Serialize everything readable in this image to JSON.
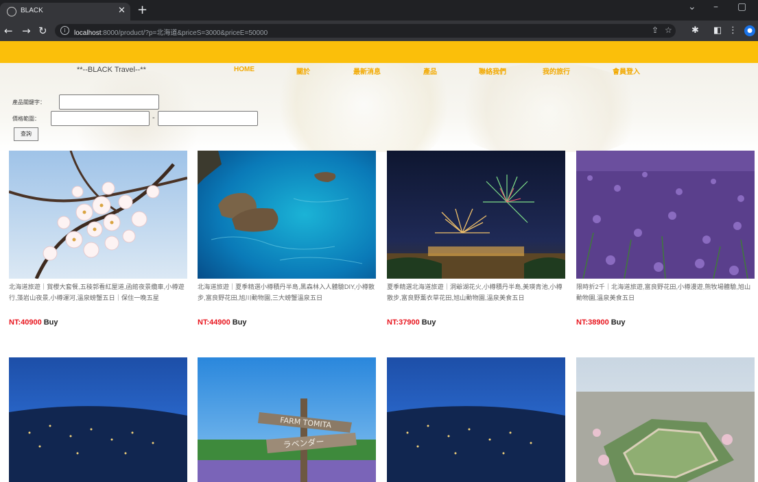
{
  "browser": {
    "tab_title": "BLACK",
    "url_host": "localhost",
    "url_rest": ":8000/product/?p=北海道&priceS=3000&priceE=50000"
  },
  "site": {
    "brand": "**--BLACK Travel--**",
    "nav": [
      "HOME",
      "關於",
      "最新消息",
      "產品",
      "聯絡我們",
      "我的旅行",
      "會員登入"
    ],
    "accent_color": "#fbbf0a",
    "nav_color": "#f2a900",
    "price_color": "#e8131c"
  },
  "search": {
    "keyword_label": "產品關鍵字：",
    "price_label": "價格範圍：",
    "price_separator": "-",
    "submit_label": "查詢"
  },
  "products": [
    {
      "desc": "北海道旅遊｜賞櫻大套餐,五稜郭看紅屋道,函館夜景纜車,小樽遊行,藻岩山夜景,小樽運河,溫泉螃蟹五日｜保住一晚五星",
      "price": "NT:40900",
      "buy": "Buy",
      "image": "cherry-blossom"
    },
    {
      "desc": "北海道旅遊｜夏季精選小樽積丹半島,黑森林入人體驗DIY,小樽散步,富良野花田,旭川動物園,三大螃蟹溫泉五日",
      "price": "NT:44900",
      "buy": "Buy",
      "image": "blue-sea-rocks"
    },
    {
      "desc": "夏季精選北海道旅遊｜洞爺湖花火,小樽積丹半島,美瑛青池,小樽散步,富良野薰衣草花田,旭山動物園,溫泉美食五日",
      "price": "NT:37900",
      "buy": "Buy",
      "image": "fireworks"
    },
    {
      "desc": "限時折2千｜北海道旅遊,富良野花田,小樽漫遊,熊牧場體驗,旭山動物園,溫泉美食五日",
      "price": "NT:38900",
      "buy": "Buy",
      "image": "lavender-field"
    },
    {
      "desc": "",
      "price": "",
      "buy": "",
      "image": "night-city"
    },
    {
      "desc": "",
      "price": "",
      "buy": "",
      "image": "farm-tomita-sign"
    },
    {
      "desc": "",
      "price": "",
      "buy": "",
      "image": "night-city"
    },
    {
      "desc": "",
      "price": "",
      "buy": "",
      "image": "star-fort"
    }
  ],
  "icons": {
    "favicon": "globe-icon",
    "close": "close-icon",
    "new_tab": "plus-icon",
    "back": "arrow-left-icon",
    "forward": "arrow-right-icon",
    "reload": "reload-icon",
    "info": "info-icon",
    "share": "share-icon",
    "bookmark": "star-icon",
    "extensions": "puzzle-icon",
    "sidebar": "sidebar-icon",
    "profile": "profile-icon"
  }
}
